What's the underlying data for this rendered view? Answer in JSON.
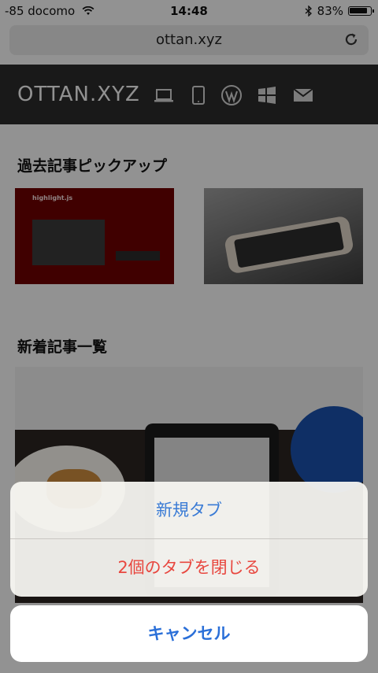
{
  "status_bar": {
    "carrier": "-85 docomo",
    "time": "14:48",
    "battery": "83%",
    "icons": [
      "wifi-icon",
      "bluetooth-icon",
      "battery-icon"
    ]
  },
  "browser": {
    "url": "ottan.xyz",
    "reload_icon": "reload-icon"
  },
  "site": {
    "title": "OTTAN.XYZ",
    "nav_icons": [
      "laptop-icon",
      "tablet-icon",
      "wordpress-icon",
      "windows-icon",
      "mail-icon"
    ],
    "header_bg": "#2b2b2b"
  },
  "sections": {
    "pickup_title": "過去記事ピックアップ",
    "recent_title": "新着記事一覧",
    "thumb1_caption": "highlight.js"
  },
  "action_sheet": {
    "new_tab": "新規タブ",
    "close_tabs": "2個のタブを閉じる",
    "cancel": "キャンセル",
    "colors": {
      "new_tab": "#3a7bd5",
      "close_tabs": "#e8473f",
      "cancel": "#2a6fd8"
    }
  }
}
